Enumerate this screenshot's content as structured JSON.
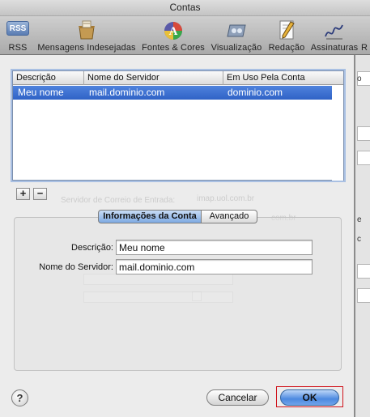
{
  "window": {
    "title": "Contas"
  },
  "toolbar": {
    "items": [
      {
        "label": "RSS",
        "icon": "rss-icon",
        "badge": "RSS"
      },
      {
        "label": "Mensagens Indesejadas",
        "icon": "junk-mail-icon"
      },
      {
        "label": "Fontes & Cores",
        "icon": "fonts-colors-icon"
      },
      {
        "label": "Visualização",
        "icon": "viewing-icon"
      },
      {
        "label": "Redação",
        "icon": "composing-icon"
      },
      {
        "label": "Assinaturas",
        "icon": "signatures-icon"
      },
      {
        "label": "R",
        "icon": "rules-icon"
      }
    ]
  },
  "accounts_table": {
    "columns": [
      "Descrição",
      "Nome do Servidor",
      "Em Uso Pela Conta"
    ],
    "rows": [
      {
        "description": "Meu nome",
        "server": "mail.dominio.com",
        "account": "dominio.com",
        "selected": true
      }
    ]
  },
  "list_buttons": {
    "add": "+",
    "remove": "−"
  },
  "tabs": {
    "info": "Informações da Conta",
    "advanced": "Avançado",
    "active": "info"
  },
  "form": {
    "description_label": "Descrição:",
    "description_value": "Meu nome",
    "server_label": "Nome do Servidor:",
    "server_value": "mail.dominio.com"
  },
  "buttons": {
    "help": "?",
    "cancel": "Cancelar",
    "ok": "OK"
  },
  "background_ghost": {
    "line1": "Servidor de Correio de Entrada:",
    "line1_value": "imap.uol.com.br",
    "line2_value": "com.br"
  },
  "rear_window": {
    "label1": "o",
    "label2": "e",
    "label3": "c"
  },
  "colors": {
    "selection": "#2f62c6",
    "ok_highlight": "#d0121b",
    "default_button": "#4d8ae0"
  }
}
